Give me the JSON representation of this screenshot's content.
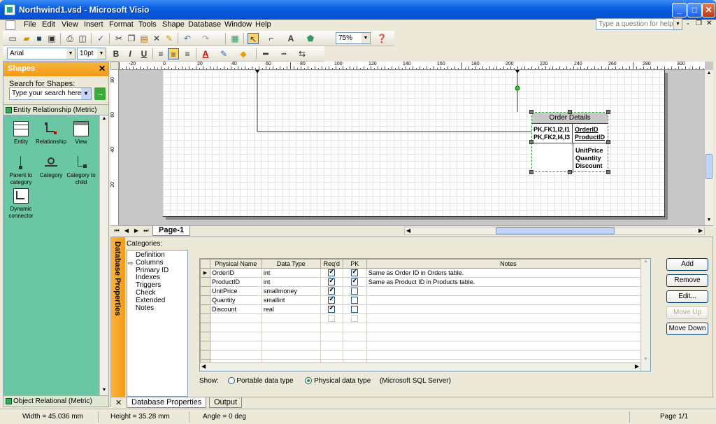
{
  "window": {
    "title": "Northwind1.vsd - Microsoft Visio",
    "controls": [
      "_",
      "□",
      "✕"
    ]
  },
  "menu": {
    "items": [
      "File",
      "Edit",
      "View",
      "Insert",
      "Format",
      "Tools",
      "Shape",
      "Database",
      "Window",
      "Help"
    ],
    "help_placeholder": "Type a question for help",
    "mdi_controls": [
      "-",
      "❐",
      "✕"
    ]
  },
  "toolbar": {
    "zoom": "75%"
  },
  "format_toolbar": {
    "font": "Arial",
    "size": "10pt",
    "bold": "B",
    "italic": "I",
    "underline": "U"
  },
  "shapes_pane": {
    "title": "Shapes",
    "search_label": "Search for Shapes:",
    "search_placeholder": "Type your search here",
    "stencil": "Entity Relationship (Metric)",
    "items": [
      {
        "label": "Entity"
      },
      {
        "label": "Relationship"
      },
      {
        "label": "View"
      },
      {
        "label": "Parent to category"
      },
      {
        "label": "Category"
      },
      {
        "label": "Category to child"
      },
      {
        "label": "Dynamic connector"
      }
    ],
    "footer_stencil": "Object Relational (Metric)"
  },
  "ruler": {
    "h_ticks": [
      "-20",
      "0",
      "20",
      "40",
      "60",
      "80",
      "100",
      "120",
      "140",
      "160",
      "180",
      "200",
      "220",
      "240",
      "260",
      "280",
      "300"
    ],
    "v_ticks": [
      "80",
      "60",
      "40",
      "20"
    ]
  },
  "drawing": {
    "page_tab": "Page-1",
    "entity": {
      "title": "Order Details",
      "pk_lines": [
        "PK,FK1,I2,I1",
        "PK,FK2,I4,I3"
      ],
      "key_fields": [
        "OrderID",
        "ProductID"
      ],
      "attributes": [
        "UnitPrice",
        "Quantity",
        "Discount"
      ]
    }
  },
  "db_properties": {
    "title": "Database Properties",
    "categories_label": "Categories:",
    "categories": [
      "Definition",
      "Columns",
      "Primary ID",
      "Indexes",
      "Triggers",
      "Check",
      "Extended",
      "Notes"
    ],
    "selected_category": "Columns",
    "columns_headers": [
      "Physical Name",
      "Data Type",
      "Req'd",
      "PK",
      "Notes"
    ],
    "rows": [
      {
        "name": "OrderID",
        "type": "int",
        "reqd": true,
        "pk": true,
        "notes": "Same as Order ID in Orders table."
      },
      {
        "name": "ProductID",
        "type": "int",
        "reqd": true,
        "pk": true,
        "notes": "Same as Product ID in Products table."
      },
      {
        "name": "UnitPrice",
        "type": "smallmoney",
        "reqd": true,
        "pk": false,
        "notes": ""
      },
      {
        "name": "Quantity",
        "type": "smallint",
        "reqd": true,
        "pk": false,
        "notes": ""
      },
      {
        "name": "Discount",
        "type": "real",
        "reqd": true,
        "pk": false,
        "notes": ""
      }
    ],
    "show_label": "Show:",
    "show_options": [
      "Portable data type",
      "Physical data type"
    ],
    "show_selected": "Physical data type",
    "db_type": "(Microsoft SQL Server)",
    "buttons": [
      "Add",
      "Remove",
      "Edit...",
      "Move Up",
      "Move Down"
    ],
    "disabled_button": "Move Up",
    "tabs": [
      "Database Properties",
      "Output"
    ]
  },
  "status": {
    "width": "Width = 45.036 mm",
    "height": "Height = 35.28 mm",
    "angle": "Angle = 0 deg",
    "page": "Page 1/1"
  },
  "colors": {
    "accent": "#f59b16",
    "stencil": "#6bc7a3",
    "titlebar": "#0a5fe0",
    "connector": "#2a9a2a"
  }
}
